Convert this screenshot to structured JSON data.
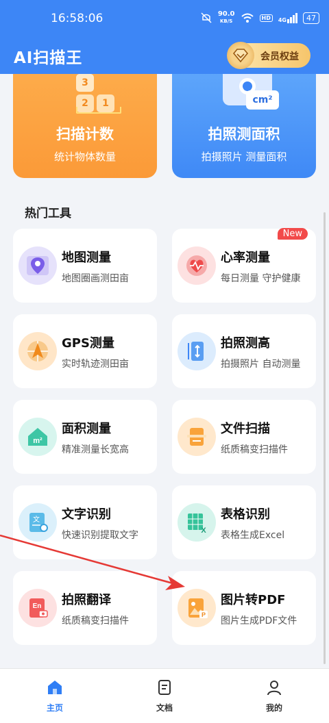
{
  "status_bar": {
    "time": "16:58:06",
    "net_speed": "90.0",
    "net_unit": "KB/S",
    "hd": "HD",
    "signal": "4G",
    "battery": "47"
  },
  "header": {
    "title": "AI扫描王",
    "vip_label": "会员权益"
  },
  "feature_cards": [
    {
      "title": "扫描计数",
      "subtitle": "统计物体数量",
      "digits": [
        "3",
        "2",
        "1"
      ]
    },
    {
      "title": "拍照测面积",
      "subtitle": "拍摄照片 测量面积",
      "badge": "cm²"
    }
  ],
  "section_title": "热门工具",
  "tools": [
    {
      "name": "地图测量",
      "desc": "地图圈画测田亩",
      "icon": "map-pin-icon"
    },
    {
      "name": "心率测量",
      "desc": "每日测量 守护健康",
      "icon": "heart-rate-icon",
      "badge": "New"
    },
    {
      "name": "GPS测量",
      "desc": "实时轨迹测田亩",
      "icon": "gps-navigation-icon"
    },
    {
      "name": "拍照测高",
      "desc": "拍摄照片 自动测量",
      "icon": "height-ruler-icon"
    },
    {
      "name": "面积测量",
      "desc": "精准测量长宽高",
      "icon": "house-area-icon",
      "icon_text": "m²"
    },
    {
      "name": "文件扫描",
      "desc": "纸质稿变扫描件",
      "icon": "document-scan-icon"
    },
    {
      "name": "文字识别",
      "desc": "快速识别提取文字",
      "icon": "text-recognition-icon",
      "icon_text": "文"
    },
    {
      "name": "表格识别",
      "desc": "表格生成Excel",
      "icon": "excel-table-icon",
      "icon_text": "X"
    },
    {
      "name": "拍照翻译",
      "desc": "纸质稿变扫描件",
      "icon": "translate-camera-icon",
      "icon_text": "En"
    },
    {
      "name": "图片转PDF",
      "desc": "图片生成PDF文件",
      "icon": "image-pdf-icon",
      "icon_text": "P"
    }
  ],
  "bottom_nav": [
    {
      "label": "主页",
      "icon": "home-icon",
      "active": true
    },
    {
      "label": "文档",
      "icon": "document-icon",
      "active": false
    },
    {
      "label": "我的",
      "icon": "user-icon",
      "active": false
    }
  ],
  "colors": {
    "primary": "#3d86f6",
    "orange_card": "#fb9a38",
    "annotation_arrow": "#e53935",
    "new_badge": "#f24a4a"
  }
}
